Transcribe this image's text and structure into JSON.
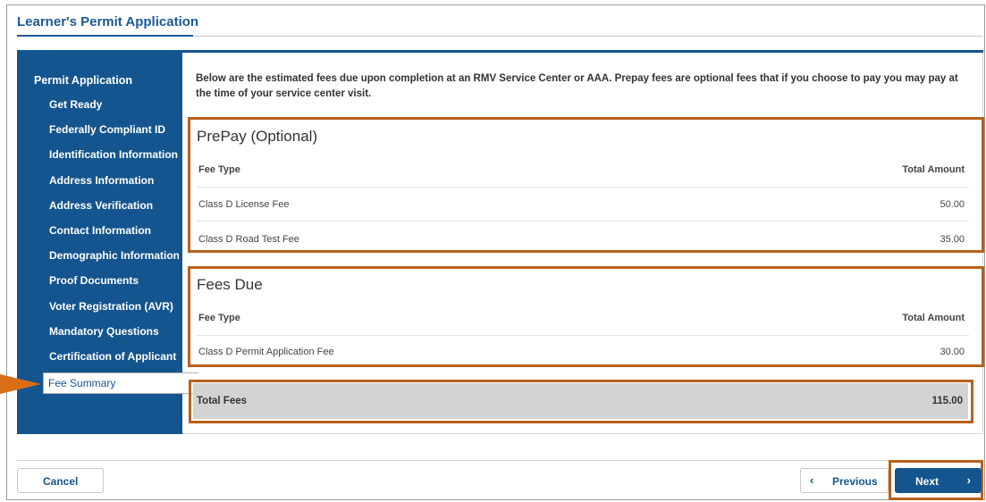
{
  "page": {
    "title": "Learner's Permit Application"
  },
  "sidebar": {
    "heading": "Permit Application",
    "items": [
      {
        "label": "Get Ready"
      },
      {
        "label": "Federally Compliant ID"
      },
      {
        "label": "Identification Information"
      },
      {
        "label": "Address Information"
      },
      {
        "label": "Address Verification"
      },
      {
        "label": "Contact Information"
      },
      {
        "label": "Demographic Information"
      },
      {
        "label": "Proof Documents"
      },
      {
        "label": "Voter Registration (AVR)"
      },
      {
        "label": "Mandatory Questions"
      },
      {
        "label": "Certification of Applicant"
      },
      {
        "label": "Fee Summary"
      }
    ],
    "active_index": 11
  },
  "intro_text": "Below are the estimated fees due upon completion at an RMV Service Center or AAA. Prepay fees are optional fees that if you choose to pay you may pay at the time of your service center visit.",
  "prepay": {
    "title": "PrePay (Optional)",
    "col_type": "Fee Type",
    "col_amount": "Total Amount",
    "rows": [
      {
        "type": "Class D License Fee",
        "amount": "50.00"
      },
      {
        "type": "Class D Road Test Fee",
        "amount": "35.00"
      }
    ]
  },
  "fees_due": {
    "title": "Fees Due",
    "col_type": "Fee Type",
    "col_amount": "Total Amount",
    "rows": [
      {
        "type": "Class D Permit Application Fee",
        "amount": "30.00"
      }
    ]
  },
  "total": {
    "label": "Total Fees",
    "amount": "115.00"
  },
  "buttons": {
    "cancel": "Cancel",
    "previous": "Previous",
    "previous_icon": "chevron-left-icon",
    "next": "Next",
    "next_icon": "chevron-right-icon"
  },
  "colors": {
    "primary": "#14558f",
    "highlight": "#b8611a",
    "arrow": "#d86e16",
    "total_bg": "#d3d3d3"
  }
}
